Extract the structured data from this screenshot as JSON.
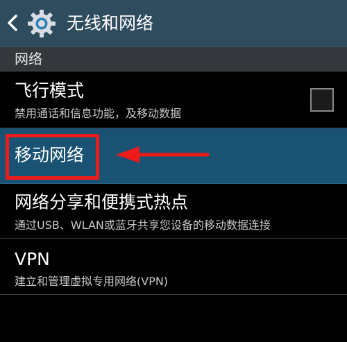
{
  "header": {
    "title": "无线和网络",
    "back_icon": "back-chevron-icon",
    "settings_icon": "gear-icon"
  },
  "section": {
    "label": "网络"
  },
  "items": [
    {
      "title": "飞行模式",
      "subtitle": "禁用通话和信息功能，及移动数据",
      "checkbox_checked": false
    },
    {
      "title": "移动网络",
      "selected": true
    },
    {
      "title": "网络分享和便携式热点",
      "subtitle": "通过USB、WLAN或蓝牙共享您设备的移动数据连接"
    },
    {
      "title": "VPN",
      "subtitle": "建立和管理虚拟专用网络(VPN)"
    }
  ],
  "colors": {
    "header_bg": "#2f4b5e",
    "section_bg": "#34383c",
    "selected_bg": "#1a5273",
    "annotation_red": "#ee1b1b"
  }
}
